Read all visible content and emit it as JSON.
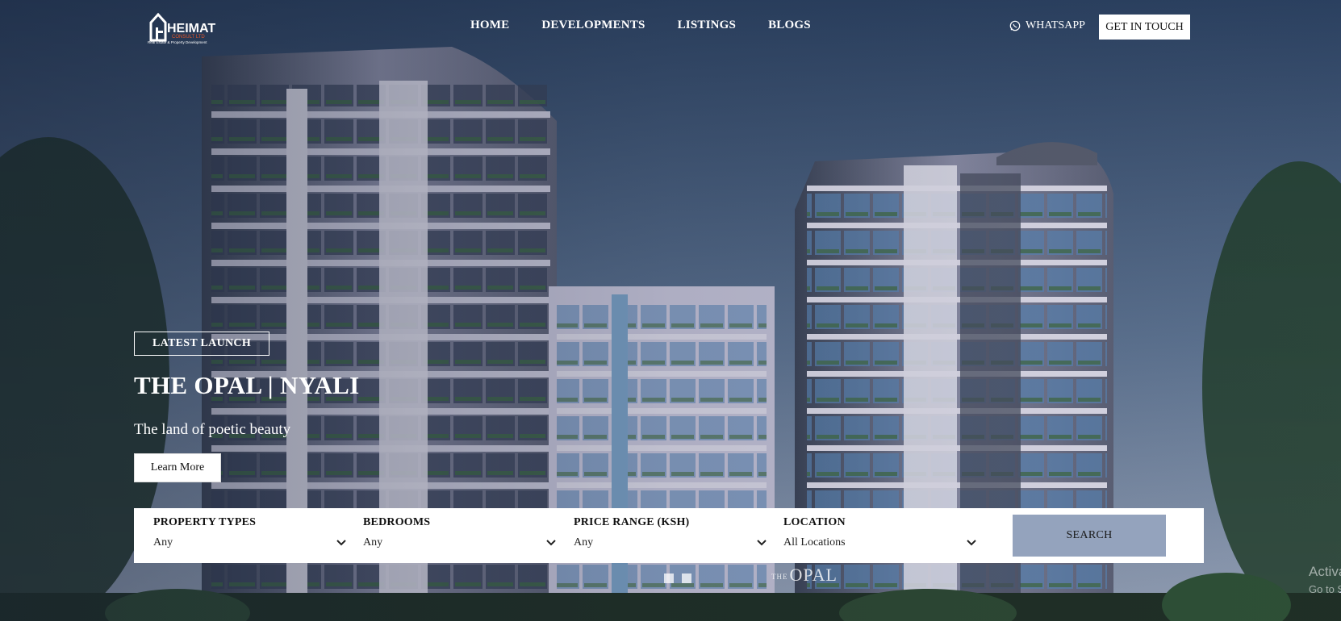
{
  "brand": {
    "name": "HEIMAT",
    "sub": "CONSULT LTD",
    "tagline": "Real Estate & Property Development"
  },
  "nav": {
    "items": [
      "HOME",
      "DEVELOPMENTS",
      "LISTINGS",
      "BLOGS"
    ],
    "whatsapp_label": "WHATSAPP",
    "whatsapp_icon": "whatsapp-icon",
    "cta_label": "GET IN TOUCH"
  },
  "hero": {
    "badge": "LATEST LAUNCH",
    "title": "THE OPAL | NYALI",
    "subtitle": "The land of poetic beauty",
    "button": "Learn More",
    "sign_prefix": "THE",
    "sign": "OPAL"
  },
  "search": {
    "fields": [
      {
        "label": "PROPERTY TYPES",
        "value": "Any"
      },
      {
        "label": "BEDROOMS",
        "value": "Any"
      },
      {
        "label": "PRICE RANGE (KSH)",
        "value": "Any"
      },
      {
        "label": "LOCATION",
        "value": "All Locations"
      }
    ],
    "button": "SEARCH",
    "button_color": "#94a3bd"
  },
  "slider": {
    "slide_count": 2
  },
  "watermark": {
    "line1": "Activat",
    "line2": "Go to Se"
  },
  "colors": {
    "brand_orange": "#e2562b",
    "sky_top": "#2a3f5c"
  }
}
